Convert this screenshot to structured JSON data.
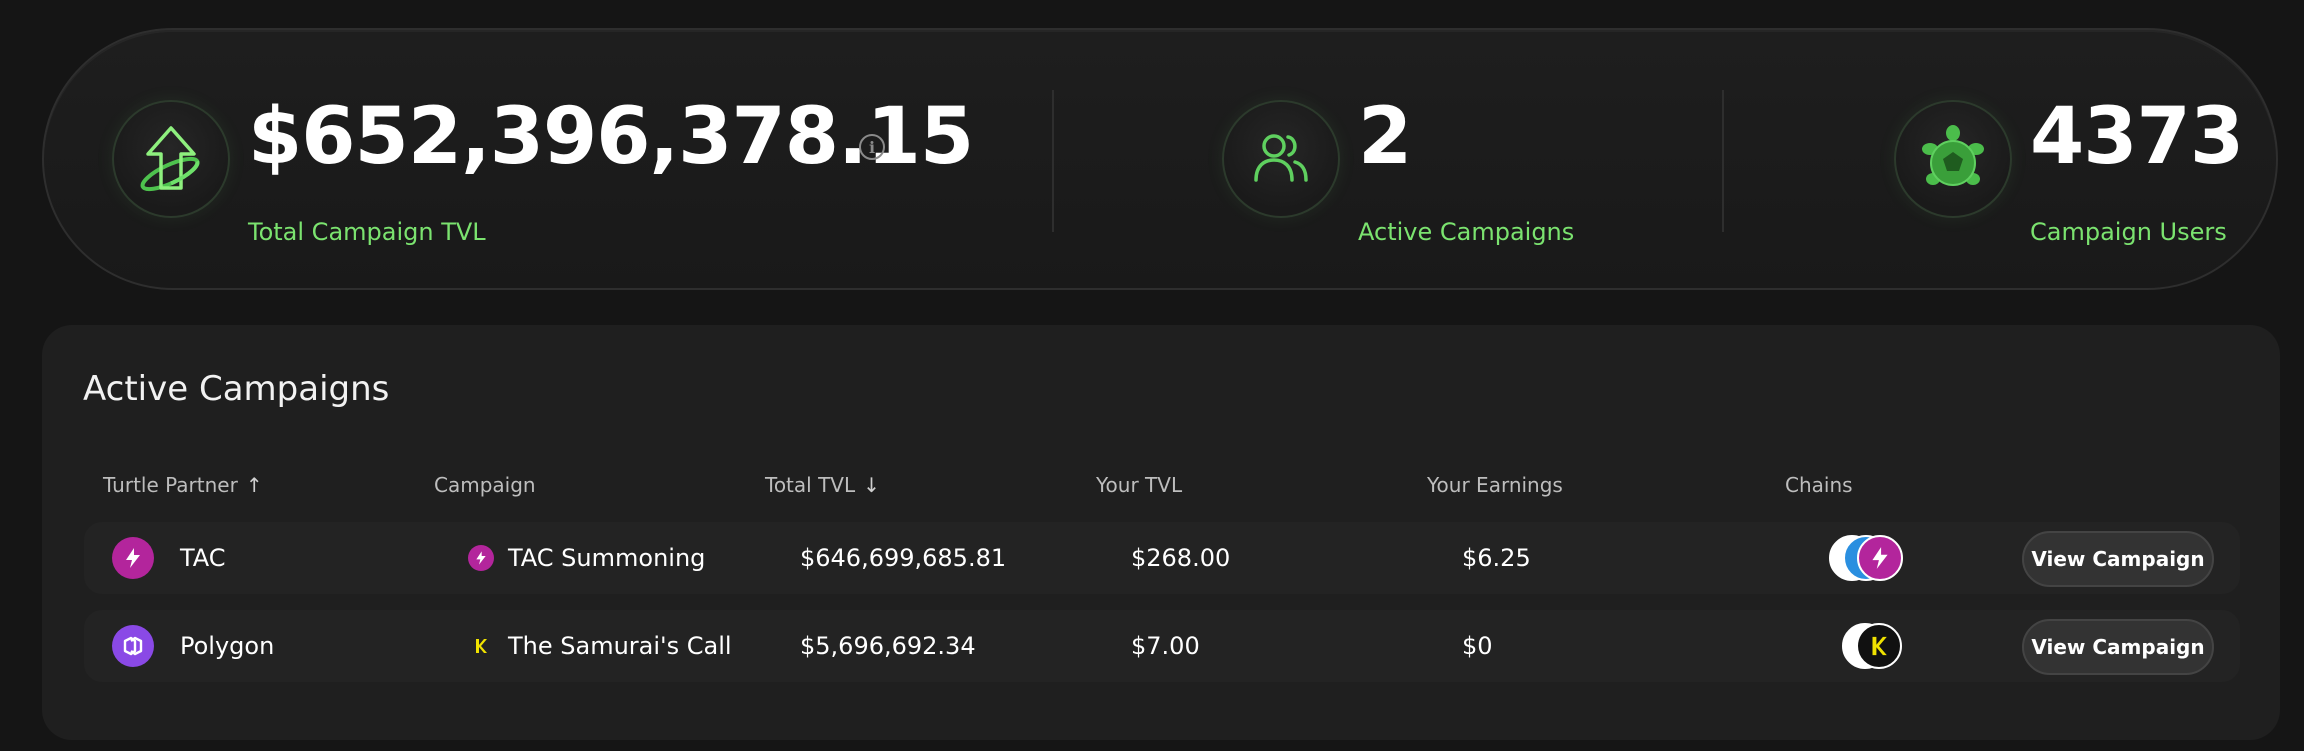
{
  "stats": {
    "tvl": {
      "value": "$652,396,378.15",
      "label": "Total Campaign TVL",
      "info": "i"
    },
    "campaigns": {
      "value": "2",
      "label": "Active Campaigns"
    },
    "users": {
      "value": "4373",
      "label": "Campaign Users"
    }
  },
  "panel": {
    "title": "Active Campaigns",
    "columns": {
      "partner": "Turtle Partner",
      "partner_sort": "↑",
      "campaign": "Campaign",
      "total_tvl": "Total TVL",
      "total_tvl_sort": "↓",
      "your_tvl": "Your TVL",
      "your_earnings": "Your Earnings",
      "chains": "Chains"
    },
    "rows": [
      {
        "partner": "TAC",
        "campaign": "TAC Summoning",
        "total_tvl": "$646,699,685.81",
        "your_tvl": "$268.00",
        "your_earnings": "$6.25",
        "button": "View Campaign"
      },
      {
        "partner": "Polygon",
        "campaign": "The Samurai's Call",
        "total_tvl": "$5,696,692.34",
        "your_tvl": "$7.00",
        "your_earnings": "$0",
        "button": "View Campaign"
      }
    ]
  },
  "colors": {
    "accent_green": "#7be36f",
    "tac_brand": "#b3259c",
    "polygon_brand": "#8a49e6"
  },
  "icons": {
    "tvl": "arrow-up-icon",
    "campaigns": "users-icon",
    "users": "turtle-icon",
    "tac": "tac-logo-icon",
    "polygon": "polygon-logo-icon",
    "samurai": "samurai-k-icon"
  }
}
